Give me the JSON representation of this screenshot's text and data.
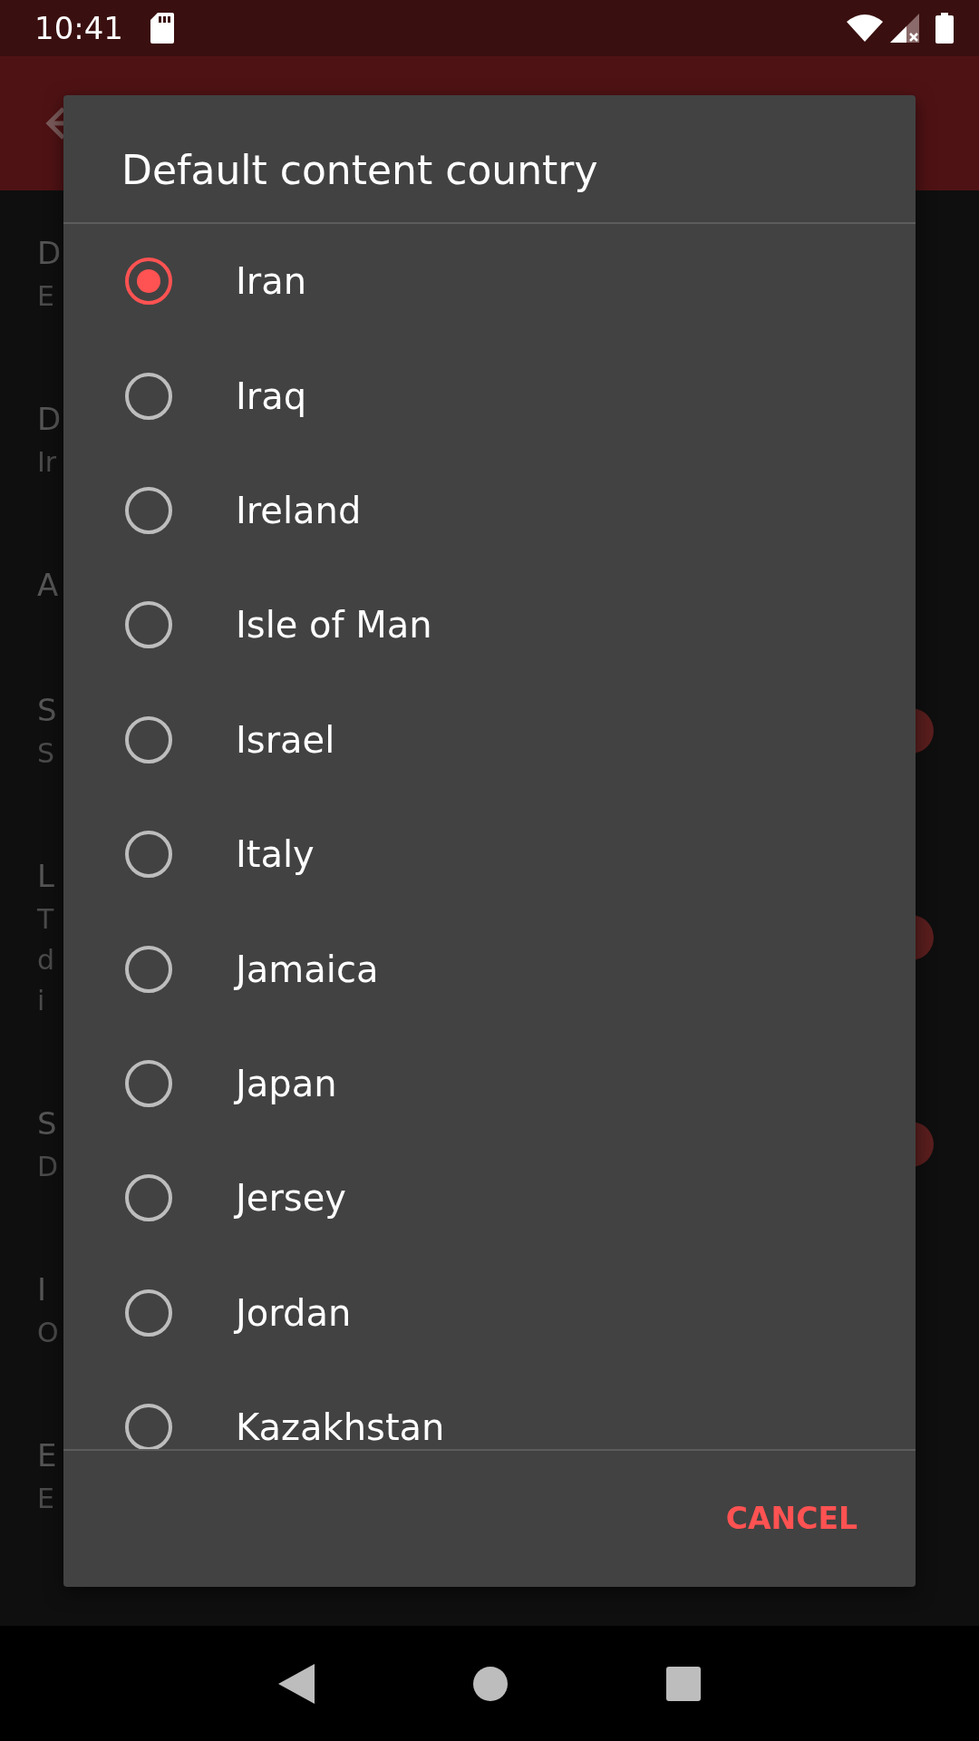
{
  "status_bar": {
    "time": "10:41"
  },
  "settings_behind": [
    {
      "kind": "text",
      "title": "D",
      "summary": [
        "E"
      ]
    },
    {
      "kind": "text",
      "title": "D",
      "summary": [
        "Ir"
      ]
    },
    {
      "kind": "text",
      "title": "A"
    },
    {
      "kind": "switch",
      "title": "S",
      "summary": [
        "S"
      ],
      "on": true
    },
    {
      "kind": "switch",
      "title": "L",
      "summary": [
        "T",
        "d",
        "i"
      ],
      "on": true
    },
    {
      "kind": "switch",
      "title": "S",
      "summary": [
        "D"
      ],
      "on": true
    },
    {
      "kind": "text",
      "title": "I",
      "summary": [
        "O"
      ]
    },
    {
      "kind": "text",
      "title": "E",
      "summary": [
        "E"
      ]
    }
  ],
  "dialog": {
    "title": "Default content country",
    "options": [
      {
        "label": "Iran",
        "selected": true
      },
      {
        "label": "Iraq",
        "selected": false
      },
      {
        "label": "Ireland",
        "selected": false
      },
      {
        "label": "Isle of Man",
        "selected": false
      },
      {
        "label": "Israel",
        "selected": false
      },
      {
        "label": "Italy",
        "selected": false
      },
      {
        "label": "Jamaica",
        "selected": false
      },
      {
        "label": "Japan",
        "selected": false
      },
      {
        "label": "Jersey",
        "selected": false
      },
      {
        "label": "Jordan",
        "selected": false
      },
      {
        "label": "Kazakhstan",
        "selected": false
      }
    ],
    "buttons": [
      "CANCEL"
    ]
  }
}
